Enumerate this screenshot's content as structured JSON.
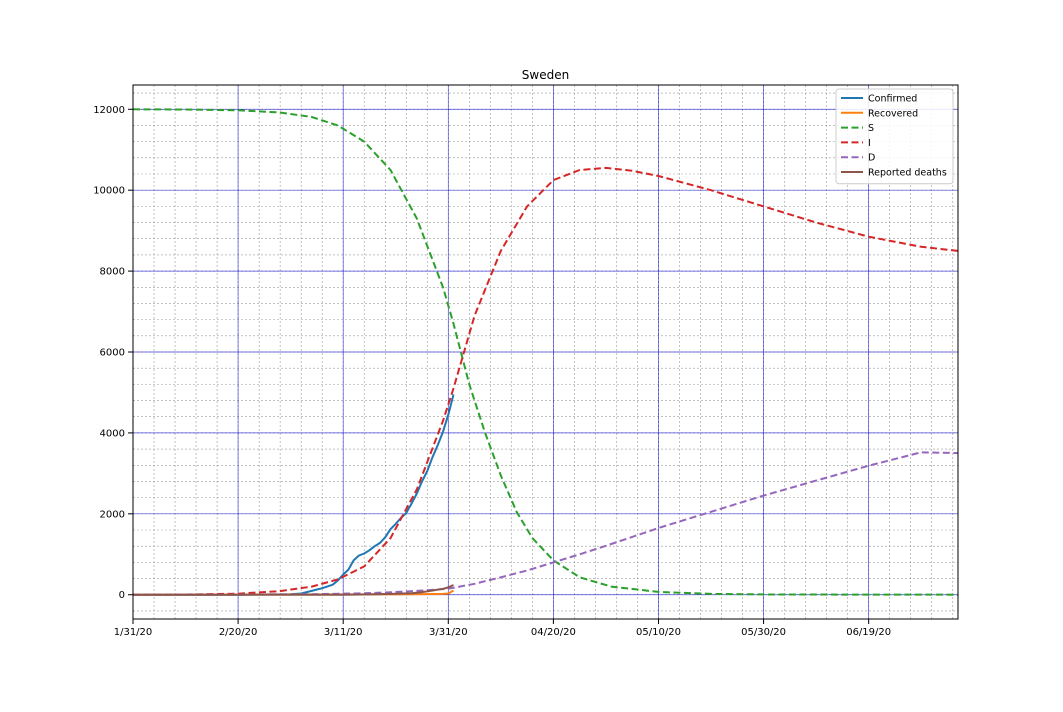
{
  "chart_data": {
    "type": "line",
    "title": "Sweden",
    "xlabel": "",
    "ylabel": "",
    "x_axis": {
      "type": "date",
      "start": "2020-01-31",
      "end": "2020-07-06",
      "tick_dates": [
        "2020-01-31",
        "2020-02-20",
        "2020-03-11",
        "2020-03-31",
        "2020-04-20",
        "2020-05-10",
        "2020-05-30",
        "2020-06-19"
      ],
      "tick_labels": [
        "1/31/20",
        "2/20/20",
        "3/11/20",
        "3/31/20",
        "04/20/20",
        "05/10/20",
        "05/30/20",
        "06/19/20"
      ]
    },
    "y_axis": {
      "ylim": [
        -600,
        12600
      ],
      "ticks": [
        0,
        2000,
        4000,
        6000,
        8000,
        10000,
        12000
      ]
    },
    "grid": {
      "major": true,
      "minor": true,
      "major_color": "#0000cc",
      "minor_color": "#999999"
    },
    "legend": {
      "position": "top-right"
    },
    "series": [
      {
        "name": "Confirmed",
        "color": "#1f77b4",
        "style": "solid",
        "points": [
          [
            "2020-01-31",
            1
          ],
          [
            "2020-02-20",
            1
          ],
          [
            "2020-02-26",
            7
          ],
          [
            "2020-03-01",
            14
          ],
          [
            "2020-03-03",
            30
          ],
          [
            "2020-03-05",
            94
          ],
          [
            "2020-03-07",
            161
          ],
          [
            "2020-03-09",
            248
          ],
          [
            "2020-03-10",
            355
          ],
          [
            "2020-03-11",
            500
          ],
          [
            "2020-03-12",
            620
          ],
          [
            "2020-03-13",
            850
          ],
          [
            "2020-03-14",
            970
          ],
          [
            "2020-03-15",
            1020
          ],
          [
            "2020-03-16",
            1100
          ],
          [
            "2020-03-17",
            1200
          ],
          [
            "2020-03-18",
            1280
          ],
          [
            "2020-03-19",
            1420
          ],
          [
            "2020-03-20",
            1620
          ],
          [
            "2020-03-21",
            1750
          ],
          [
            "2020-03-22",
            1900
          ],
          [
            "2020-03-23",
            2020
          ],
          [
            "2020-03-24",
            2250
          ],
          [
            "2020-03-25",
            2500
          ],
          [
            "2020-03-26",
            2800
          ],
          [
            "2020-03-27",
            3060
          ],
          [
            "2020-03-28",
            3400
          ],
          [
            "2020-03-29",
            3700
          ],
          [
            "2020-03-30",
            4030
          ],
          [
            "2020-03-31",
            4450
          ],
          [
            "2020-04-01",
            4950
          ]
        ]
      },
      {
        "name": "Recovered",
        "color": "#ff7f0e",
        "style": "solid",
        "points": [
          [
            "2020-01-31",
            0
          ],
          [
            "2020-03-24",
            10
          ],
          [
            "2020-03-30",
            20
          ],
          [
            "2020-03-31",
            30
          ],
          [
            "2020-04-01",
            105
          ]
        ]
      },
      {
        "name": "S",
        "color": "#2ca02c",
        "style": "dashed",
        "points": [
          [
            "2020-01-31",
            12000
          ],
          [
            "2020-02-10",
            11995
          ],
          [
            "2020-02-20",
            11975
          ],
          [
            "2020-02-28",
            11920
          ],
          [
            "2020-03-05",
            11810
          ],
          [
            "2020-03-10",
            11600
          ],
          [
            "2020-03-15",
            11200
          ],
          [
            "2020-03-20",
            10500
          ],
          [
            "2020-03-25",
            9300
          ],
          [
            "2020-03-30",
            7600
          ],
          [
            "2020-04-01",
            6700
          ],
          [
            "2020-04-04",
            5200
          ],
          [
            "2020-04-07",
            4000
          ],
          [
            "2020-04-10",
            2950
          ],
          [
            "2020-04-13",
            2050
          ],
          [
            "2020-04-16",
            1400
          ],
          [
            "2020-04-20",
            850
          ],
          [
            "2020-04-25",
            430
          ],
          [
            "2020-05-01",
            200
          ],
          [
            "2020-05-10",
            70
          ],
          [
            "2020-05-20",
            20
          ],
          [
            "2020-06-01",
            5
          ],
          [
            "2020-07-06",
            0
          ]
        ]
      },
      {
        "name": "I",
        "color": "#d62728",
        "style": "dashed",
        "points": [
          [
            "2020-01-31",
            0
          ],
          [
            "2020-02-10",
            5
          ],
          [
            "2020-02-20",
            25
          ],
          [
            "2020-02-28",
            90
          ],
          [
            "2020-03-05",
            200
          ],
          [
            "2020-03-10",
            380
          ],
          [
            "2020-03-15",
            700
          ],
          [
            "2020-03-20",
            1400
          ],
          [
            "2020-03-25",
            2600
          ],
          [
            "2020-03-30",
            4300
          ],
          [
            "2020-04-01",
            5100
          ],
          [
            "2020-04-05",
            6900
          ],
          [
            "2020-04-10",
            8500
          ],
          [
            "2020-04-15",
            9600
          ],
          [
            "2020-04-20",
            10250
          ],
          [
            "2020-04-25",
            10500
          ],
          [
            "2020-04-30",
            10550
          ],
          [
            "2020-05-05",
            10480
          ],
          [
            "2020-05-10",
            10350
          ],
          [
            "2020-05-20",
            10000
          ],
          [
            "2020-05-30",
            9600
          ],
          [
            "2020-06-09",
            9200
          ],
          [
            "2020-06-19",
            8850
          ],
          [
            "2020-06-29",
            8600
          ],
          [
            "2020-07-06",
            8500
          ]
        ]
      },
      {
        "name": "D",
        "color": "#9467bd",
        "style": "dashed",
        "points": [
          [
            "2020-01-31",
            0
          ],
          [
            "2020-02-20",
            3
          ],
          [
            "2020-03-05",
            12
          ],
          [
            "2020-03-15",
            35
          ],
          [
            "2020-03-20",
            60
          ],
          [
            "2020-03-25",
            95
          ],
          [
            "2020-03-31",
            150
          ],
          [
            "2020-04-05",
            270
          ],
          [
            "2020-04-10",
            430
          ],
          [
            "2020-04-15",
            600
          ],
          [
            "2020-04-20",
            800
          ],
          [
            "2020-04-25",
            1000
          ],
          [
            "2020-04-30",
            1210
          ],
          [
            "2020-05-05",
            1430
          ],
          [
            "2020-05-10",
            1650
          ],
          [
            "2020-05-20",
            2050
          ],
          [
            "2020-05-30",
            2450
          ],
          [
            "2020-06-09",
            2820
          ],
          [
            "2020-06-19",
            3190
          ],
          [
            "2020-06-29",
            3520
          ],
          [
            "2020-07-06",
            3500
          ]
        ]
      },
      {
        "name": "Reported deaths",
        "color": "#8c564b",
        "style": "solid",
        "points": [
          [
            "2020-01-31",
            0
          ],
          [
            "2020-03-11",
            1
          ],
          [
            "2020-03-16",
            8
          ],
          [
            "2020-03-20",
            20
          ],
          [
            "2020-03-24",
            36
          ],
          [
            "2020-03-26",
            62
          ],
          [
            "2020-03-28",
            105
          ],
          [
            "2020-03-30",
            146
          ],
          [
            "2020-03-31",
            180
          ],
          [
            "2020-04-01",
            240
          ]
        ]
      }
    ]
  }
}
